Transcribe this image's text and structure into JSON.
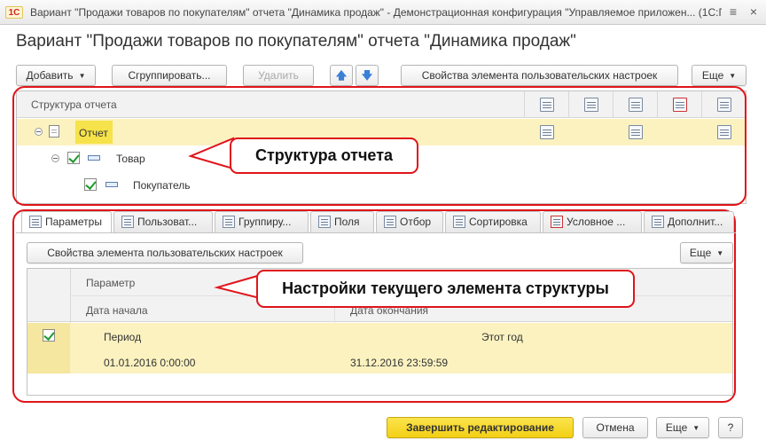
{
  "window": {
    "logo": "1С",
    "title": "Вариант \"Продажи товаров по покупателям\" отчета \"Динамика продаж\" - Демонстрационная конфигурация \"Управляемое приложен... (1С:Предприятие)",
    "menu_glyph": "≡",
    "close_glyph": "×"
  },
  "heading": "Вариант \"Продажи товаров по покупателям\" отчета \"Динамика продаж\"",
  "toolbar": {
    "add": "Добавить",
    "group": "Сгруппировать...",
    "delete": "Удалить",
    "up": "🡅",
    "down": "🡇",
    "props": "Свойства элемента пользовательских настроек",
    "more": "Еще"
  },
  "structure": {
    "header": "Структура отчета",
    "rows": [
      {
        "label": "Отчет"
      },
      {
        "label": "Товар"
      },
      {
        "label": "Покупатель"
      }
    ]
  },
  "callouts": {
    "structure": "Структура отчета",
    "settings": "Настройки текущего элемента структуры"
  },
  "tabs": [
    {
      "label": "Параметры"
    },
    {
      "label": "Пользоват..."
    },
    {
      "label": "Группиру..."
    },
    {
      "label": "Поля"
    },
    {
      "label": "Отбор"
    },
    {
      "label": "Сортировка"
    },
    {
      "label": "Условное ..."
    },
    {
      "label": "Дополнит..."
    }
  ],
  "settings": {
    "props_button": "Свойства элемента пользовательских настроек",
    "more": "Еще",
    "col_param": "Параметр",
    "col_start": "Дата начала",
    "col_end": "Дата окончания",
    "row": {
      "name": "Период",
      "value": "Этот год",
      "start": "01.01.2016 0:00:00",
      "end": "31.12.2016 23:59:59"
    }
  },
  "footer": {
    "finish": "Завершить редактирование",
    "cancel": "Отмена",
    "more": "Еще",
    "help": "?"
  },
  "colors": {
    "accent_yellow": "#f3cf15",
    "selection": "#fbf2c0",
    "highlight_red": "#e0141a"
  }
}
